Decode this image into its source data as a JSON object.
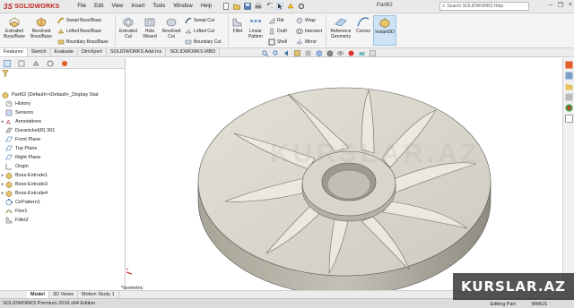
{
  "app": {
    "logo_text": "SOLIDWORKS",
    "menu": [
      "File",
      "Edit",
      "View",
      "Insert",
      "Tools",
      "Window",
      "Help"
    ],
    "document_title": "Part62",
    "search_placeholder": "Search SOLIDWORKS Help"
  },
  "ribbon": {
    "extruded_boss": "Extruded Boss/Base",
    "revolved_boss": "Revolved Boss/Base",
    "swept_boss": "Swept Boss/Base",
    "lofted_boss": "Lofted Boss/Base",
    "boundary_boss": "Boundary Boss/Base",
    "extruded_cut": "Extruded Cut",
    "hole_wizard": "Hole Wizard",
    "revolved_cut": "Revolved Cut",
    "swept_cut": "Swept Cut",
    "lofted_cut": "Lofted Cut",
    "boundary_cut": "Boundary Cut",
    "fillet": "Fillet",
    "linear_pattern": "Linear Pattern",
    "rib": "Rib",
    "draft": "Draft",
    "shell": "Shell",
    "wrap": "Wrap",
    "intersect": "Intersect",
    "mirror": "Mirror",
    "reference_geometry": "Reference Geometry",
    "curves": "Curves",
    "instant3d": "Instant3D"
  },
  "command_tabs": [
    "Features",
    "Sketch",
    "Evaluate",
    "DimXpert",
    "SOLIDWORKS Add-Ins",
    "SOLIDWORKS MBD"
  ],
  "feature_tree": {
    "root": "Part62  (Default<<Default>_Display Stat",
    "items": [
      {
        "label": "History",
        "expand": ""
      },
      {
        "label": "Sensors",
        "expand": ""
      },
      {
        "label": "Annotations",
        "expand": "▸"
      },
      {
        "label": "Duranickel(R) 301",
        "expand": ""
      },
      {
        "label": "Front Plane",
        "expand": ""
      },
      {
        "label": "Top Plane",
        "expand": ""
      },
      {
        "label": "Right Plane",
        "expand": ""
      },
      {
        "label": "Origin",
        "expand": ""
      },
      {
        "label": "Boss-Extrude1",
        "expand": "▸"
      },
      {
        "label": "Boss-Extrude3",
        "expand": "▸"
      },
      {
        "label": "Boss-Extrude4",
        "expand": "▸"
      },
      {
        "label": "CirPattern1",
        "expand": ""
      },
      {
        "label": "Flex1",
        "expand": ""
      },
      {
        "label": "Fillet2",
        "expand": ""
      }
    ]
  },
  "viewport": {
    "view_label": "*Isometric",
    "watermark": "KURSLAR.AZ"
  },
  "bottom_tabs": [
    "Model",
    "3D Views",
    "Motion Study 1"
  ],
  "status": {
    "left": "SOLIDWORKS Premium 2016 x64 Edition",
    "mode": "Editing Part",
    "units": "MMGS"
  },
  "brand_overlay": "KURSLAR.AZ",
  "colors": {
    "accent_red": "#c0241c",
    "part_face": "#d9d6cc",
    "part_shadow": "#8f8b80"
  }
}
